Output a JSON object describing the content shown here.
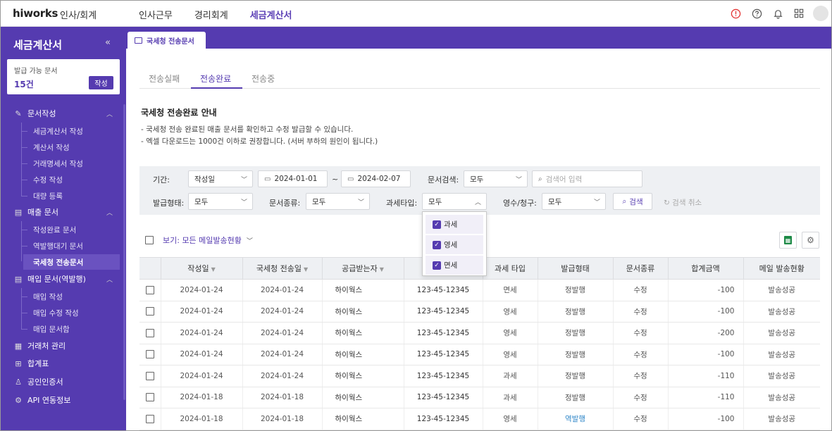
{
  "app": {
    "logo": "hiworks",
    "module": "인사/회계"
  },
  "top_nav": [
    {
      "label": "인사근무",
      "active": false
    },
    {
      "label": "경리회계",
      "active": false
    },
    {
      "label": "세금계산서",
      "active": true
    }
  ],
  "top_icons": [
    "alert-icon",
    "help-icon",
    "bell-icon",
    "apps-grid-icon",
    "avatar"
  ],
  "sidebar": {
    "title": "세금계산서",
    "collapse_glyph": "«",
    "issue_box": {
      "label": "발급 가능 문서",
      "count": "15건",
      "button": "작성"
    },
    "sections": [
      {
        "label": "문서작성",
        "icon": "pencil-icon",
        "items": [
          "세금계산서 작성",
          "계산서 작성",
          "거래명세서 작성",
          "수정 작성",
          "대량 등록"
        ]
      },
      {
        "label": "매출 문서",
        "icon": "document-icon",
        "items": [
          "작성완료 문서",
          "역발행대기 문서",
          "국세청 전송문서"
        ]
      },
      {
        "label": "매입 문서(역발행)",
        "icon": "document-icon",
        "items": [
          "매입 작성",
          "매입 수정 작성",
          "매입 문서함"
        ]
      }
    ],
    "active_item": "국세청 전송문서",
    "links": [
      {
        "label": "거래처 관리",
        "icon": "building-icon"
      },
      {
        "label": "합계표",
        "icon": "table-icon"
      },
      {
        "label": "공인인증서",
        "icon": "certificate-icon"
      },
      {
        "label": "API 연동정보",
        "icon": "api-icon"
      }
    ]
  },
  "doc_tab": {
    "label": "국세청 전송문서"
  },
  "subtabs": [
    {
      "label": "전송실패",
      "active": false
    },
    {
      "label": "전송완료",
      "active": true
    },
    {
      "label": "전송중",
      "active": false
    }
  ],
  "notice": {
    "title": "국세청 전송완료 안내",
    "lines": [
      "- 국세청 전송 완료된 매출 문서를 확인하고 수정 발급할 수 있습니다.",
      "- 엑셀 다운로드는 1000건 이하로 권장합니다. (서버 부하의 원인이 됩니다.)"
    ]
  },
  "filters": {
    "period_label": "기간:",
    "period_type": "작성일",
    "date_from": "2024-01-01",
    "date_sep": "~",
    "date_to": "2024-02-07",
    "search_label": "문서검색:",
    "search_scope": "모두",
    "search_placeholder": "검색어 입력",
    "issue_type_label": "발급형태:",
    "issue_type": "모두",
    "doc_kind_label": "문서종류:",
    "doc_kind": "모두",
    "tax_type_label": "과세타입:",
    "tax_type": "모두",
    "receipt_label": "영수/청구:",
    "receipt": "모두",
    "search_button": "검색",
    "reset_button": "검색 취소"
  },
  "tax_dropdown": [
    {
      "label": "과세",
      "checked": true
    },
    {
      "label": "영세",
      "checked": true
    },
    {
      "label": "면세",
      "checked": true
    }
  ],
  "view": {
    "label": "보기: 모든 메일발송현황"
  },
  "table": {
    "columns": [
      "작성일",
      "국세청 전송일",
      "공급받는자",
      "",
      "과세 타입",
      "발급형태",
      "문서종류",
      "합계금액",
      "메일 발송현황"
    ],
    "rows": [
      {
        "date": "2024-01-24",
        "sent": "2024-01-24",
        "buyer": "하이웍스",
        "regno": "123-45-12345",
        "tax": "면세",
        "issue": "정발행",
        "kind": "수정",
        "amount": "-100",
        "mail": "발송성공"
      },
      {
        "date": "2024-01-24",
        "sent": "2024-01-24",
        "buyer": "하이웍스",
        "regno": "123-45-12345",
        "tax": "영세",
        "issue": "정발행",
        "kind": "수정",
        "amount": "-100",
        "mail": "발송성공"
      },
      {
        "date": "2024-01-24",
        "sent": "2024-01-24",
        "buyer": "하이웍스",
        "regno": "123-45-12345",
        "tax": "영세",
        "issue": "정발행",
        "kind": "수정",
        "amount": "-200",
        "mail": "발송성공"
      },
      {
        "date": "2024-01-24",
        "sent": "2024-01-24",
        "buyer": "하이웍스",
        "regno": "123-45-12345",
        "tax": "영세",
        "issue": "정발행",
        "kind": "수정",
        "amount": "-100",
        "mail": "발송성공"
      },
      {
        "date": "2024-01-24",
        "sent": "2024-01-24",
        "buyer": "하이웍스",
        "regno": "123-45-12345",
        "tax": "과세",
        "issue": "정발행",
        "kind": "수정",
        "amount": "-110",
        "mail": "발송성공"
      },
      {
        "date": "2024-01-18",
        "sent": "2024-01-18",
        "buyer": "하이웍스",
        "regno": "123-45-12345",
        "tax": "과세",
        "issue": "정발행",
        "kind": "수정",
        "amount": "-110",
        "mail": "발송성공"
      },
      {
        "date": "2024-01-18",
        "sent": "2024-01-18",
        "buyer": "하이웍스",
        "regno": "123-45-12345",
        "tax": "영세",
        "issue": "역발행",
        "kind": "수정",
        "amount": "-100",
        "mail": "발송성공"
      }
    ]
  },
  "colors": {
    "brand": "#553bb0",
    "link": "#2f86c8",
    "alert": "#e33333",
    "excel": "#1e8a47"
  }
}
